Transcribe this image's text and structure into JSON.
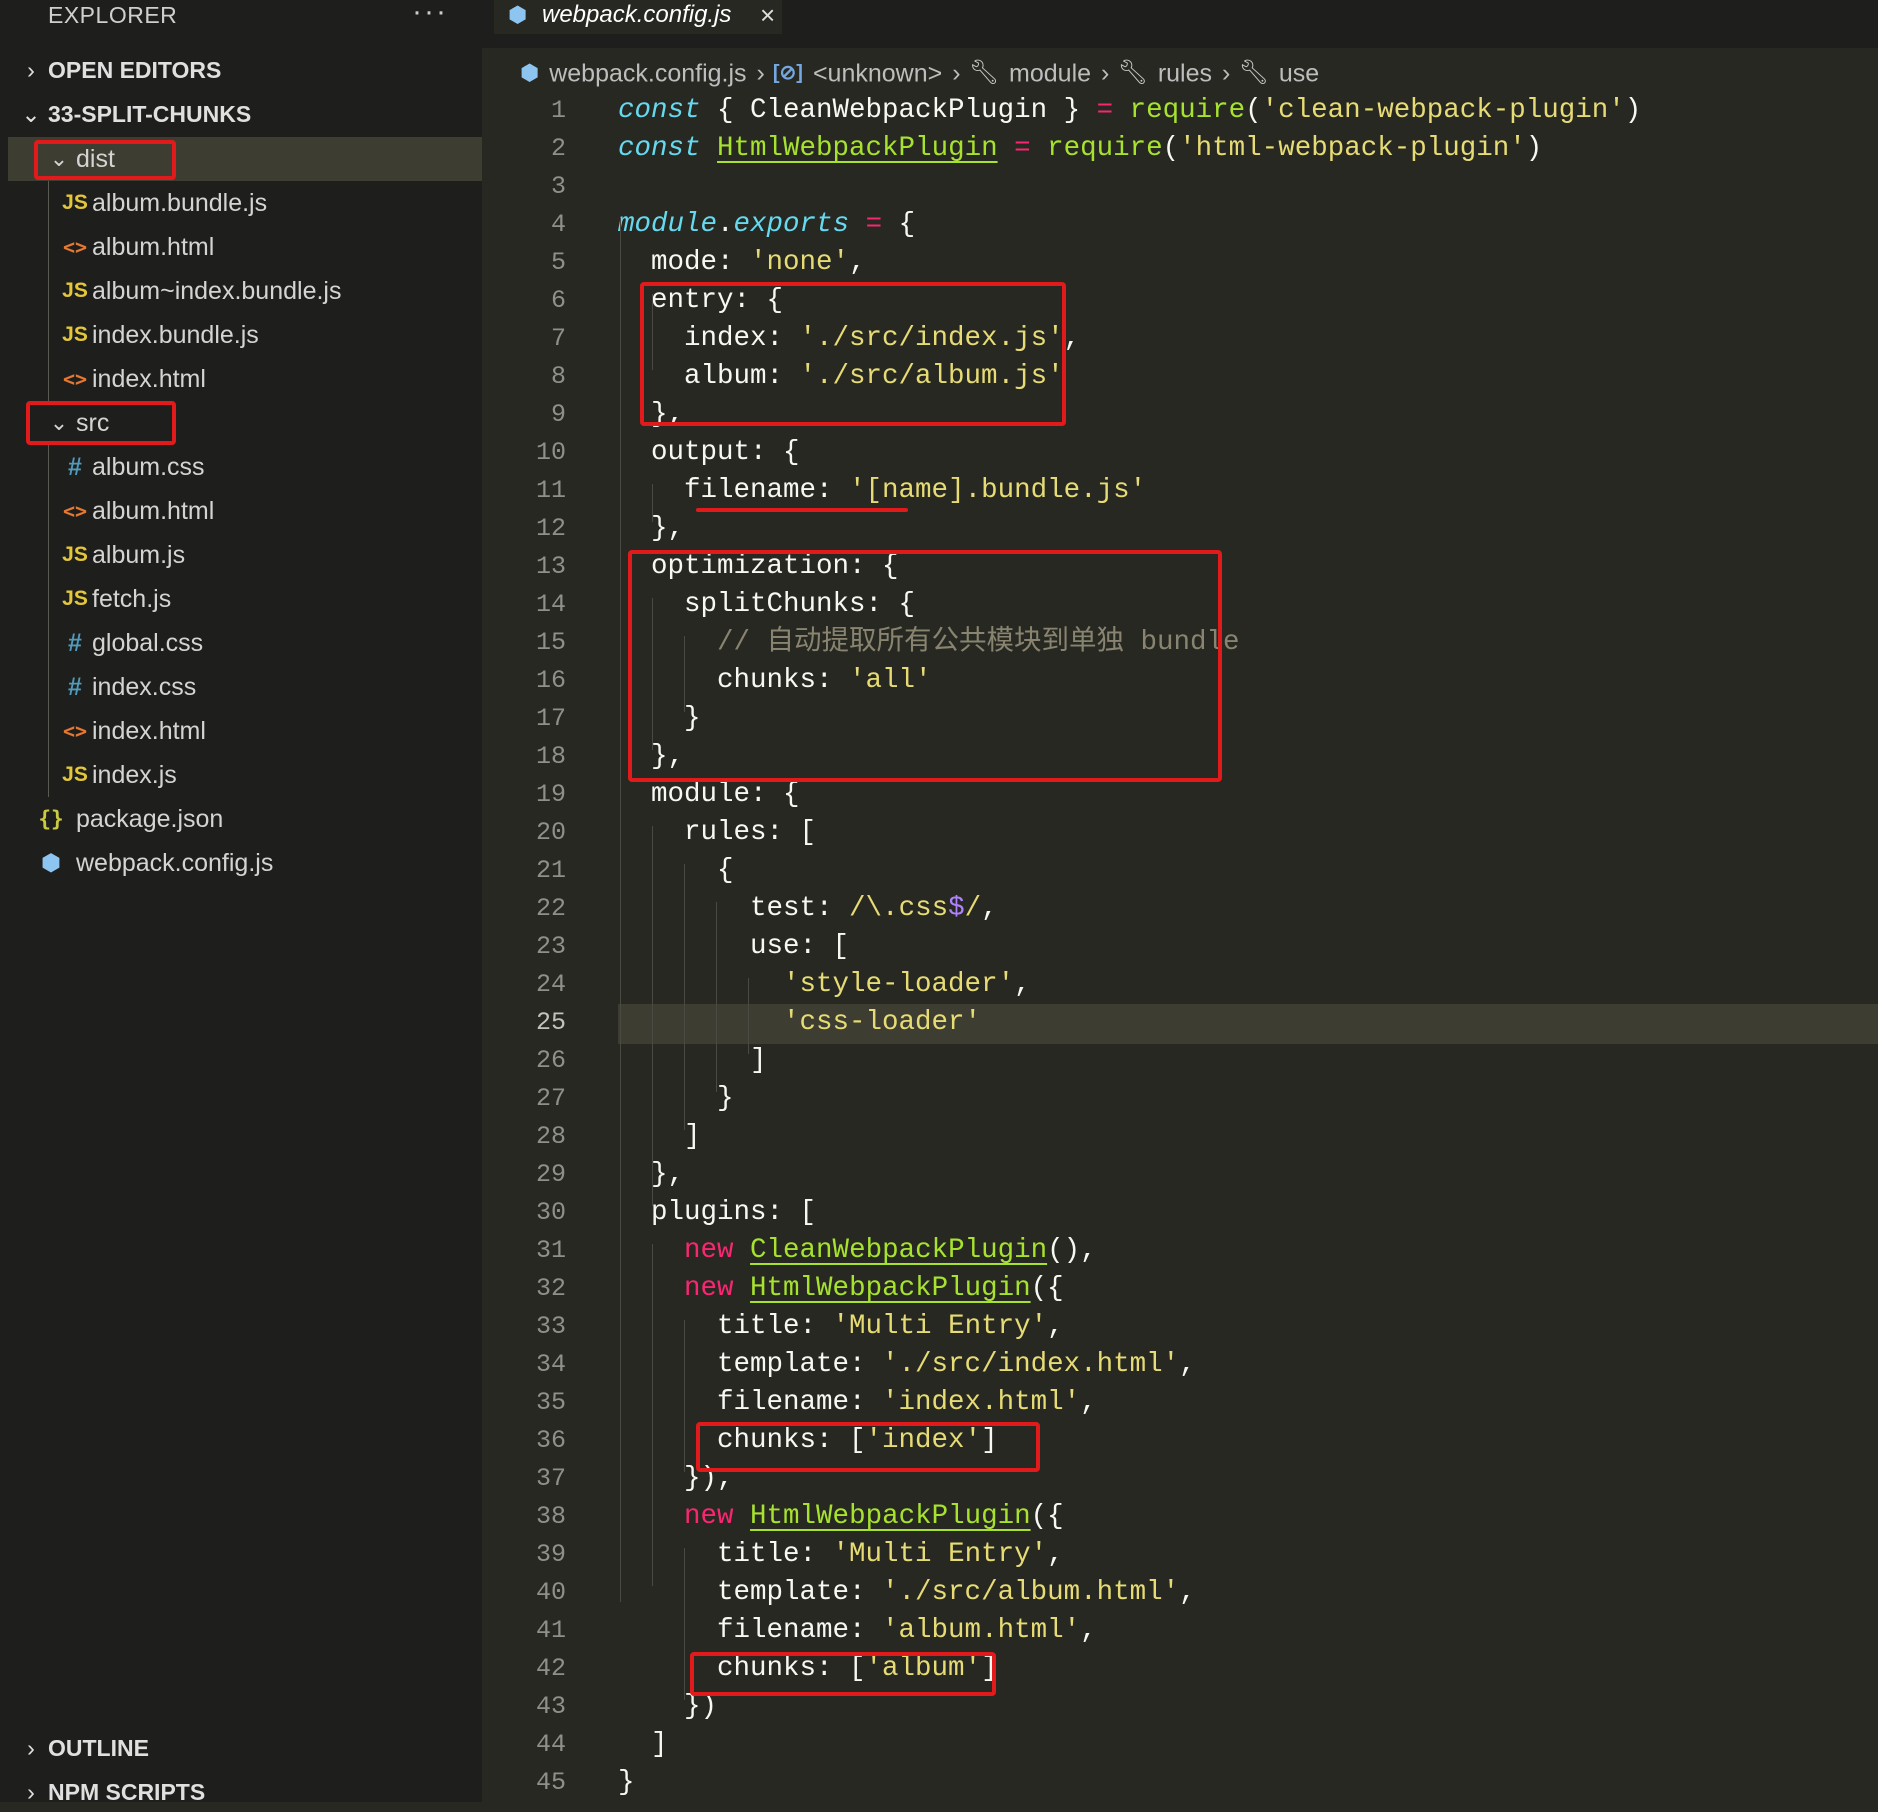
{
  "explorer": {
    "title": "EXPLORER",
    "more_label": "···",
    "sections": {
      "open_editors": "OPEN EDITORS",
      "project": "33-SPLIT-CHUNKS",
      "outline": "OUTLINE",
      "npm_scripts": "NPM SCRIPTS"
    },
    "chevrons": {
      "collapsed": "›",
      "expanded": "⌄"
    },
    "icons": {
      "js": "JS",
      "html": "<>",
      "css": "#",
      "json": "{}",
      "cube": "⬢"
    },
    "tree": {
      "dist": "dist",
      "dist_files": [
        "album.bundle.js",
        "album.html",
        "album~index.bundle.js",
        "index.bundle.js",
        "index.html"
      ],
      "src": "src",
      "src_files": [
        "album.css",
        "album.html",
        "album.js",
        "fetch.js",
        "global.css",
        "index.css",
        "index.html",
        "index.js"
      ],
      "root_files": [
        "package.json",
        "webpack.config.js"
      ]
    }
  },
  "tab": {
    "label": "webpack.config.js",
    "close": "×"
  },
  "breadcrumb": {
    "file": "webpack.config.js",
    "var_icon": "[⊘]",
    "sep": "›",
    "items": [
      "<unknown>",
      "module",
      "rules",
      "use"
    ]
  },
  "editor": {
    "current_line": 25,
    "lines": [
      {
        "n": "1",
        "t": [
          [
            "kw",
            "const"
          ],
          [
            "pl",
            " { CleanWebpackPlugin } "
          ],
          [
            "op",
            "="
          ],
          [
            "pl",
            " "
          ],
          [
            "fn",
            "require"
          ],
          [
            "pl",
            "("
          ],
          [
            "str",
            "'clean-webpack-plugin'"
          ],
          [
            "pl",
            ")"
          ]
        ]
      },
      {
        "n": "2",
        "t": [
          [
            "kw",
            "const"
          ],
          [
            "pl",
            " "
          ],
          [
            "cls",
            "HtmlWebpackPlugin"
          ],
          [
            "pl",
            " "
          ],
          [
            "op",
            "="
          ],
          [
            "pl",
            " "
          ],
          [
            "fn",
            "require"
          ],
          [
            "pl",
            "("
          ],
          [
            "str",
            "'html-webpack-plugin'"
          ],
          [
            "pl",
            ")"
          ]
        ]
      },
      {
        "n": "3",
        "t": []
      },
      {
        "n": "4",
        "t": [
          [
            "kw",
            "module"
          ],
          [
            "pl",
            "."
          ],
          [
            "kw",
            "exports"
          ],
          [
            "pl",
            " "
          ],
          [
            "op",
            "="
          ],
          [
            "pl",
            " {"
          ]
        ]
      },
      {
        "n": "5",
        "t": [
          [
            "pl",
            "  mode: "
          ],
          [
            "str",
            "'none'"
          ],
          [
            "pl",
            ","
          ]
        ]
      },
      {
        "n": "6",
        "t": [
          [
            "pl",
            "  entry: {"
          ]
        ]
      },
      {
        "n": "7",
        "t": [
          [
            "pl",
            "    index: "
          ],
          [
            "str",
            "'./src/index.js'"
          ],
          [
            "pl",
            ","
          ]
        ]
      },
      {
        "n": "8",
        "t": [
          [
            "pl",
            "    album: "
          ],
          [
            "str",
            "'./src/album.js'"
          ]
        ]
      },
      {
        "n": "9",
        "t": [
          [
            "pl",
            "  },"
          ]
        ]
      },
      {
        "n": "10",
        "t": [
          [
            "pl",
            "  output: {"
          ]
        ]
      },
      {
        "n": "11",
        "t": [
          [
            "pl",
            "    filename: "
          ],
          [
            "str",
            "'[name].bundle.js'"
          ]
        ]
      },
      {
        "n": "12",
        "t": [
          [
            "pl",
            "  },"
          ]
        ]
      },
      {
        "n": "13",
        "t": [
          [
            "pl",
            "  optimization: {"
          ]
        ]
      },
      {
        "n": "14",
        "t": [
          [
            "pl",
            "    splitChunks: {"
          ]
        ]
      },
      {
        "n": "15",
        "t": [
          [
            "cm",
            "      // 自动提取所有公共模块到单独 bundle"
          ]
        ]
      },
      {
        "n": "16",
        "t": [
          [
            "pl",
            "      chunks: "
          ],
          [
            "str",
            "'all'"
          ]
        ]
      },
      {
        "n": "17",
        "t": [
          [
            "pl",
            "    }"
          ]
        ]
      },
      {
        "n": "18",
        "t": [
          [
            "pl",
            "  },"
          ]
        ]
      },
      {
        "n": "19",
        "t": [
          [
            "pl",
            "  module: {"
          ]
        ]
      },
      {
        "n": "20",
        "t": [
          [
            "pl",
            "    rules: ["
          ]
        ]
      },
      {
        "n": "21",
        "t": [
          [
            "pl",
            "      {"
          ]
        ]
      },
      {
        "n": "22",
        "t": [
          [
            "pl",
            "        test: "
          ],
          [
            "rx",
            "/\\."
          ],
          [
            "rx",
            "css"
          ],
          [
            "rxe",
            "$"
          ],
          [
            "rx",
            "/"
          ],
          [
            "pl",
            ","
          ]
        ]
      },
      {
        "n": "23",
        "t": [
          [
            "pl",
            "        use: ["
          ]
        ]
      },
      {
        "n": "24",
        "t": [
          [
            "pl",
            "          "
          ],
          [
            "str",
            "'style-loader'"
          ],
          [
            "pl",
            ","
          ]
        ]
      },
      {
        "n": "25",
        "t": [
          [
            "pl",
            "          "
          ],
          [
            "str",
            "'css-loader'"
          ]
        ]
      },
      {
        "n": "26",
        "t": [
          [
            "pl",
            "        ]"
          ]
        ]
      },
      {
        "n": "27",
        "t": [
          [
            "pl",
            "      }"
          ]
        ]
      },
      {
        "n": "28",
        "t": [
          [
            "pl",
            "    ]"
          ]
        ]
      },
      {
        "n": "29",
        "t": [
          [
            "pl",
            "  },"
          ]
        ]
      },
      {
        "n": "30",
        "t": [
          [
            "pl",
            "  plugins: ["
          ]
        ]
      },
      {
        "n": "31",
        "t": [
          [
            "pl",
            "    "
          ],
          [
            "new",
            "new"
          ],
          [
            "pl",
            " "
          ],
          [
            "cls",
            "CleanWebpackPlugin"
          ],
          [
            "pl",
            "(),"
          ]
        ]
      },
      {
        "n": "32",
        "t": [
          [
            "pl",
            "    "
          ],
          [
            "new",
            "new"
          ],
          [
            "pl",
            " "
          ],
          [
            "cls",
            "HtmlWebpackPlugin"
          ],
          [
            "pl",
            "({"
          ]
        ]
      },
      {
        "n": "33",
        "t": [
          [
            "pl",
            "      title: "
          ],
          [
            "str",
            "'Multi Entry'"
          ],
          [
            "pl",
            ","
          ]
        ]
      },
      {
        "n": "34",
        "t": [
          [
            "pl",
            "      template: "
          ],
          [
            "str",
            "'./src/index.html'"
          ],
          [
            "pl",
            ","
          ]
        ]
      },
      {
        "n": "35",
        "t": [
          [
            "pl",
            "      filename: "
          ],
          [
            "str",
            "'index.html'"
          ],
          [
            "pl",
            ","
          ]
        ]
      },
      {
        "n": "36",
        "t": [
          [
            "pl",
            "      chunks: ["
          ],
          [
            "str",
            "'index'"
          ],
          [
            "pl",
            "]"
          ]
        ]
      },
      {
        "n": "37",
        "t": [
          [
            "pl",
            "    }),"
          ]
        ]
      },
      {
        "n": "38",
        "t": [
          [
            "pl",
            "    "
          ],
          [
            "new",
            "new"
          ],
          [
            "pl",
            " "
          ],
          [
            "cls",
            "HtmlWebpackPlugin"
          ],
          [
            "pl",
            "({"
          ]
        ]
      },
      {
        "n": "39",
        "t": [
          [
            "pl",
            "      title: "
          ],
          [
            "str",
            "'Multi Entry'"
          ],
          [
            "pl",
            ","
          ]
        ]
      },
      {
        "n": "40",
        "t": [
          [
            "pl",
            "      template: "
          ],
          [
            "str",
            "'./src/album.html'"
          ],
          [
            "pl",
            ","
          ]
        ]
      },
      {
        "n": "41",
        "t": [
          [
            "pl",
            "      filename: "
          ],
          [
            "str",
            "'album.html'"
          ],
          [
            "pl",
            ","
          ]
        ]
      },
      {
        "n": "42",
        "t": [
          [
            "pl",
            "      chunks: ["
          ],
          [
            "str",
            "'album'"
          ],
          [
            "pl",
            "]"
          ]
        ]
      },
      {
        "n": "43",
        "t": [
          [
            "pl",
            "    })"
          ]
        ]
      },
      {
        "n": "44",
        "t": [
          [
            "pl",
            "  ]"
          ]
        ]
      },
      {
        "n": "45",
        "t": [
          [
            "pl",
            "}"
          ]
        ]
      }
    ]
  },
  "colors": {
    "annotation": "#e11b1b",
    "keyword": "#66d9ef",
    "string": "#e6db74",
    "function": "#a6e22e",
    "operator": "#f92672",
    "comment": "#88846f"
  }
}
